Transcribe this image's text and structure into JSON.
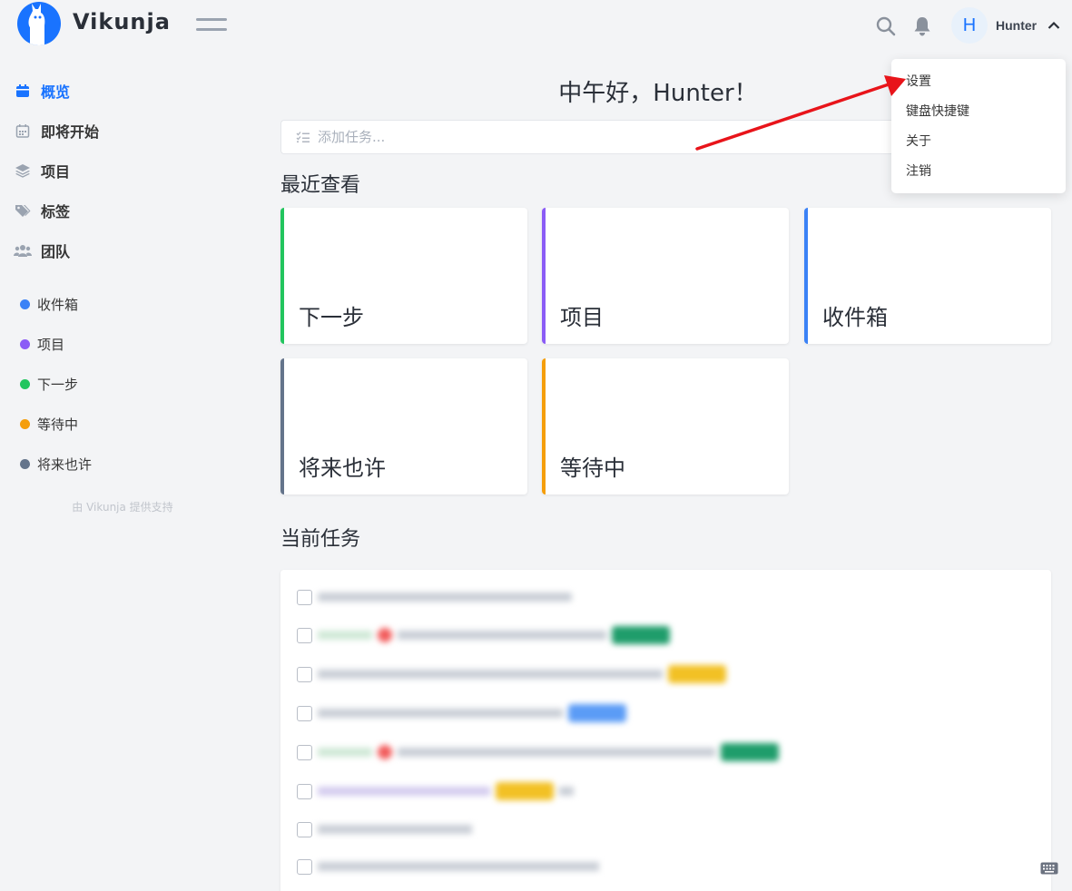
{
  "app": {
    "brand": "Vikunja",
    "accent_color": "#1973ff"
  },
  "header": {
    "user_initial": "H",
    "username": "Hunter"
  },
  "user_dropdown": {
    "items": [
      "设置",
      "键盘快捷键",
      "关于",
      "注销"
    ]
  },
  "sidebar": {
    "nav": [
      {
        "label": "概览",
        "icon": "calendar-icon",
        "active": true
      },
      {
        "label": "即将开始",
        "icon": "calendar-grid-icon",
        "active": false
      },
      {
        "label": "项目",
        "icon": "layers-icon",
        "active": false
      },
      {
        "label": "标签",
        "icon": "tags-icon",
        "active": false
      },
      {
        "label": "团队",
        "icon": "users-icon",
        "active": false
      }
    ],
    "projects": [
      {
        "label": "收件箱",
        "color": "#3b82f6"
      },
      {
        "label": "项目",
        "color": "#8b5cf6"
      },
      {
        "label": "下一步",
        "color": "#22c55e"
      },
      {
        "label": "等待中",
        "color": "#f59e0b"
      },
      {
        "label": "将来也许",
        "color": "#64748b"
      }
    ],
    "powered_by": "由 Vikunja 提供支持"
  },
  "main": {
    "greeting": "中午好，Hunter！",
    "add_task_placeholder": "添加任务...",
    "recent_title": "最近查看",
    "recent_projects": [
      {
        "title": "下一步",
        "color": "#22c55e"
      },
      {
        "title": "项目",
        "color": "#8b5cf6"
      },
      {
        "title": "收件箱",
        "color": "#3b82f6"
      },
      {
        "title": "将来也许",
        "color": "#64748b"
      },
      {
        "title": "等待中",
        "color": "#f59e0b"
      }
    ],
    "current_tasks_title": "当前任务"
  }
}
